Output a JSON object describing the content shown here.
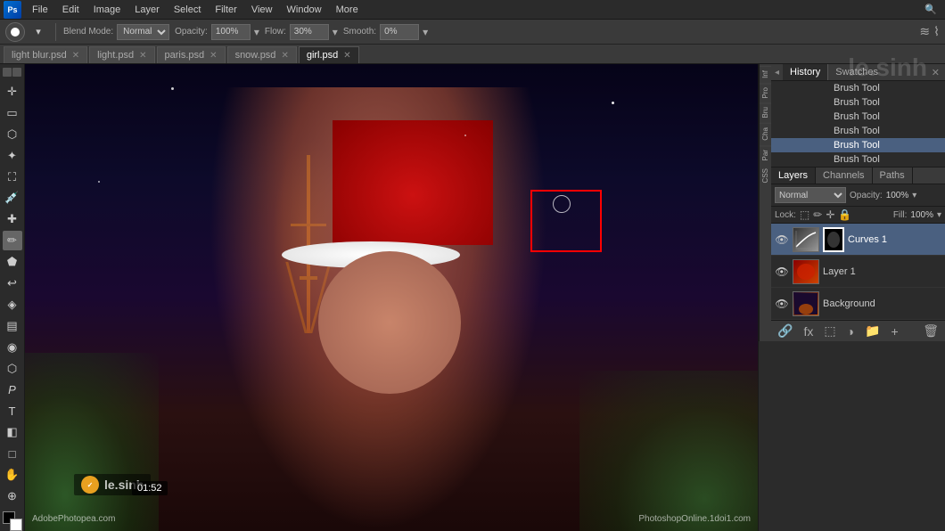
{
  "app": {
    "title": "Photoshop",
    "menubar": {
      "items": [
        "File",
        "Edit",
        "Image",
        "Layer",
        "Select",
        "Filter",
        "View",
        "Window",
        "More"
      ]
    }
  },
  "toolbar": {
    "brush_icon": "✏",
    "blend_mode_label": "Blend Mode:",
    "blend_mode_value": "Normal",
    "opacity_label": "Opacity:",
    "opacity_value": "100%",
    "flow_label": "Flow:",
    "flow_value": "30%",
    "smooth_label": "Smooth:",
    "smooth_value": "0%"
  },
  "tabs": [
    {
      "label": "light blur.psd",
      "id": "tab-light-blur",
      "active": false
    },
    {
      "label": "light.psd",
      "id": "tab-light",
      "active": false
    },
    {
      "label": "paris.psd",
      "id": "tab-paris",
      "active": false
    },
    {
      "label": "snow.psd",
      "id": "tab-snow",
      "active": false
    },
    {
      "label": "girl.psd",
      "id": "tab-girl",
      "active": true
    }
  ],
  "left_tools": [
    {
      "icon": "↕",
      "name": "move-tool",
      "label": "Move"
    },
    {
      "icon": "▭",
      "name": "marquee-tool",
      "label": "Marquee"
    },
    {
      "icon": "⬡",
      "name": "lasso-tool",
      "label": "Lasso"
    },
    {
      "icon": "✦",
      "name": "magic-wand-tool",
      "label": "Magic Wand"
    },
    {
      "icon": "✂",
      "name": "crop-tool",
      "label": "Crop"
    },
    {
      "icon": "🔍",
      "name": "eyedropper-tool",
      "label": "Eyedropper"
    },
    {
      "icon": "🖌",
      "name": "healing-tool",
      "label": "Healing"
    },
    {
      "icon": "✏",
      "name": "brush-tool",
      "label": "Brush",
      "active": true
    },
    {
      "icon": "⬜",
      "name": "clone-tool",
      "label": "Clone"
    },
    {
      "icon": "◎",
      "name": "history-brush",
      "label": "History Brush"
    },
    {
      "icon": "◈",
      "name": "eraser-tool",
      "label": "Eraser"
    },
    {
      "icon": "🌊",
      "name": "gradient-tool",
      "label": "Gradient"
    },
    {
      "icon": "◉",
      "name": "blur-tool",
      "label": "Blur"
    },
    {
      "icon": "⬡",
      "name": "dodge-tool",
      "label": "Dodge"
    },
    {
      "icon": "P",
      "name": "pen-tool",
      "label": "Pen"
    },
    {
      "icon": "T",
      "name": "type-tool",
      "label": "Type"
    },
    {
      "icon": "◧",
      "name": "path-selection",
      "label": "Path Selection"
    },
    {
      "icon": "□",
      "name": "shape-tool",
      "label": "Shape"
    },
    {
      "icon": "👆",
      "name": "hand-tool",
      "label": "Hand"
    },
    {
      "icon": "🔍",
      "name": "zoom-tool",
      "label": "Zoom"
    }
  ],
  "right": {
    "mini_tabs": [
      "Inf",
      "Pro",
      "Bru",
      "Cha",
      "Par",
      "CSS"
    ],
    "history": {
      "tabs": [
        "History",
        "Swatches"
      ],
      "active_tab": "History",
      "items": [
        {
          "label": "Brush Tool",
          "active": false
        },
        {
          "label": "Brush Tool",
          "active": false
        },
        {
          "label": "Brush Tool",
          "active": false
        },
        {
          "label": "Brush Tool",
          "active": false
        },
        {
          "label": "Brush Tool",
          "active": true
        },
        {
          "label": "Brush Tool",
          "active": false
        }
      ]
    },
    "layers": {
      "tabs": [
        "Layers",
        "Channels",
        "Paths"
      ],
      "active_tab": "Layers",
      "blend_mode": "Normal",
      "opacity": "100%",
      "fill": "100%",
      "items": [
        {
          "name": "Curves 1",
          "visible": true,
          "active": true,
          "has_mask": true,
          "mask_active": true,
          "type": "curves"
        },
        {
          "name": "Layer 1",
          "visible": true,
          "active": false,
          "has_mask": false,
          "type": "layer1"
        },
        {
          "name": "Background",
          "visible": true,
          "active": false,
          "has_mask": false,
          "type": "background"
        }
      ]
    }
  },
  "canvas": {
    "selection_box": true
  },
  "status": {
    "left": "AdobePhotopea.com",
    "center": "PhotoshopOnline.1doi1.com",
    "timer": "01:52",
    "logo": "le.sinh"
  }
}
